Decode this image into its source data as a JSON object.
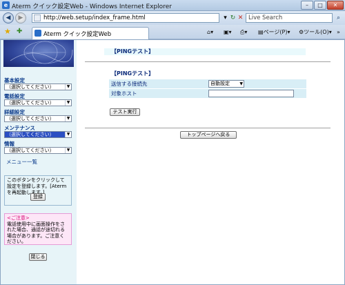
{
  "window": {
    "title": "Aterm クイック設定Web - Windows Internet Explorer",
    "minimize": "–",
    "maximize": "□",
    "close": "✕"
  },
  "addressbar": {
    "url": "http://web.setup/index_frame.html",
    "search_placeholder": "Live Search"
  },
  "tab": {
    "label": "Aterm クイック設定Web"
  },
  "commandbar": {
    "page_menu": "ページ(P)",
    "tools_menu": "ツール(O)"
  },
  "sidebar": {
    "groups": [
      {
        "label": "基本設定",
        "value": "（選択してください）"
      },
      {
        "label": "電話設定",
        "value": "（選択してください）"
      },
      {
        "label": "詳細設定",
        "value": "（選択してください）"
      },
      {
        "label": "メンテナンス",
        "value": "（選択してください）"
      },
      {
        "label": "情報",
        "value": "（選択してください）"
      }
    ],
    "menu_list_link": "メニュー一覧",
    "register_note": "このボタンをクリックして設定を登録します。[Atermを再起動します。]",
    "register_button": "登録",
    "caution_title": "<ご注意>",
    "caution_text": "電話使用中に画面操作をされた場合、通話が途切れる場合があります。ご注意ください。",
    "close_button": "閉じる"
  },
  "main": {
    "page_title": "【PINGテスト】",
    "section_title": "【PINGテスト】",
    "fields": [
      {
        "label": "送信する接続先",
        "value": "自動設定"
      },
      {
        "label": "対象ホスト",
        "value": ""
      }
    ],
    "run_test_button": "テスト実行",
    "back_to_top_button": "トップページへ戻る"
  }
}
